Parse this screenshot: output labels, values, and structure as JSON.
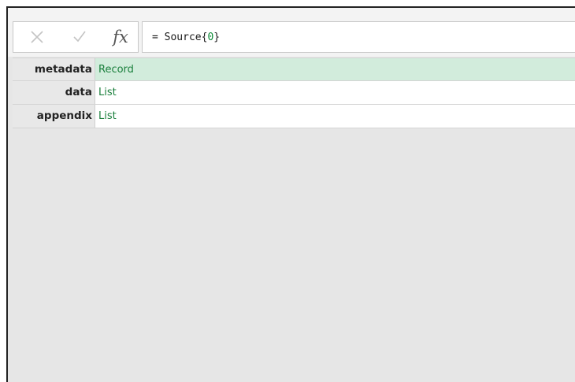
{
  "formula_bar": {
    "cancel_icon": "close-icon",
    "commit_icon": "check-icon",
    "fx_label": "fx",
    "formula_prefix": "= Source{",
    "formula_index": "0",
    "formula_suffix": "}"
  },
  "record_rows": [
    {
      "field": "metadata",
      "value": "Record",
      "selected": true
    },
    {
      "field": "data",
      "value": "List",
      "selected": false
    },
    {
      "field": "appendix",
      "value": "List",
      "selected": false
    }
  ],
  "colors": {
    "selected_row": "#d2ecdc",
    "value_text": "#1a7f3c",
    "canvas": "#e6e6e6"
  }
}
